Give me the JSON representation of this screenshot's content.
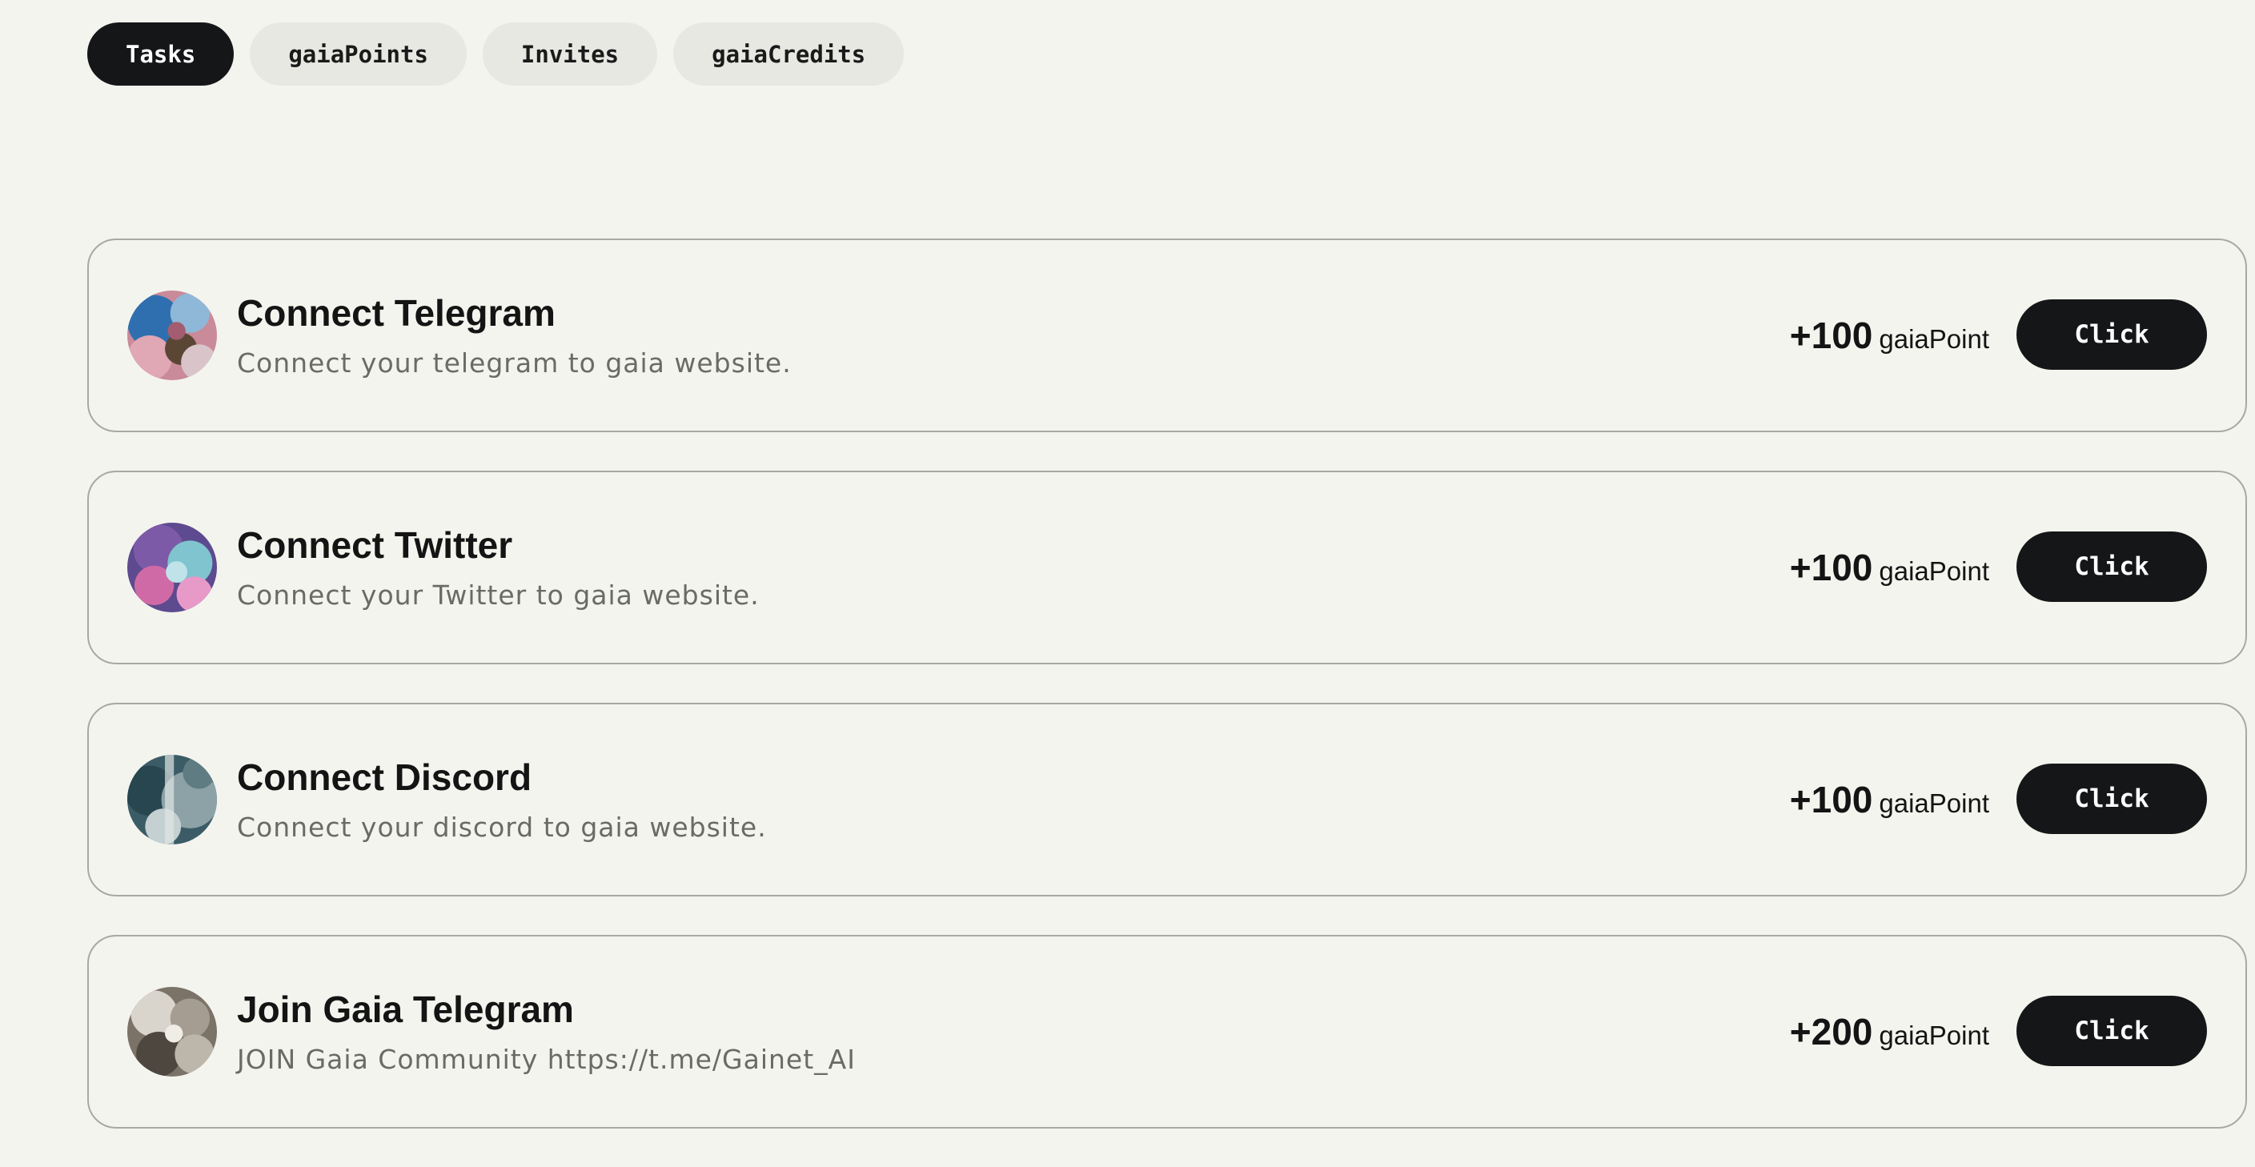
{
  "tabs": [
    {
      "label": "Tasks",
      "active": true
    },
    {
      "label": "gaiaPoints",
      "active": false
    },
    {
      "label": "Invites",
      "active": false
    },
    {
      "label": "gaiaCredits",
      "active": false
    }
  ],
  "tasks": [
    {
      "title": "Connect Telegram",
      "description": "Connect your telegram to gaia website.",
      "reward_amount": "+100",
      "reward_unit": "gaiaPoint",
      "button_label": "Click",
      "avatar_icon": "abstract-pink-blue-avatar-icon"
    },
    {
      "title": "Connect Twitter",
      "description": "Connect your Twitter to gaia website.",
      "reward_amount": "+100",
      "reward_unit": "gaiaPoint",
      "button_label": "Click",
      "avatar_icon": "abstract-purple-cyan-avatar-icon"
    },
    {
      "title": "Connect Discord",
      "description": "Connect your discord to gaia website.",
      "reward_amount": "+100",
      "reward_unit": "gaiaPoint",
      "button_label": "Click",
      "avatar_icon": "abstract-teal-grey-avatar-icon"
    },
    {
      "title": "Join Gaia Telegram",
      "description": "JOIN Gaia Community https://t.me/Gainet_AI",
      "reward_amount": "+200",
      "reward_unit": "gaiaPoint",
      "button_label": "Click",
      "avatar_icon": "abstract-grey-texture-avatar-icon"
    }
  ]
}
